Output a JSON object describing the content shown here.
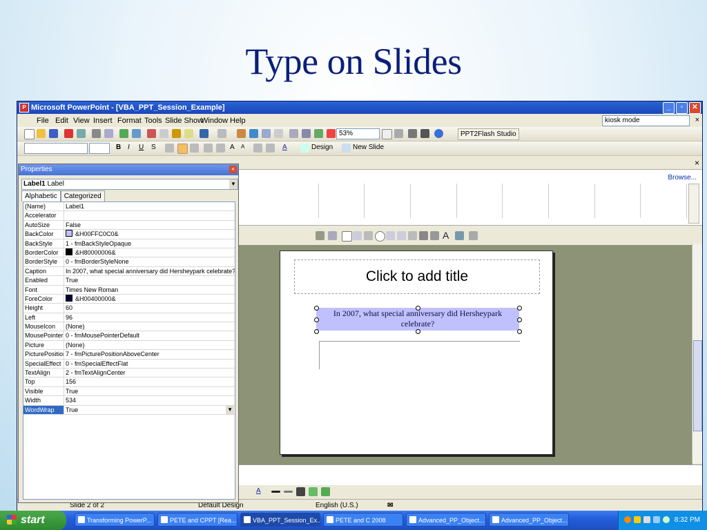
{
  "slide_title": "Type on Slides",
  "window": {
    "title": "Microsoft PowerPoint - [VBA_PPT_Session_Example]",
    "buttons": [
      "_",
      "▫",
      "✕"
    ]
  },
  "menu": {
    "items": [
      "File",
      "Edit",
      "View",
      "Insert",
      "Format",
      "Tools",
      "Slide Show",
      "Window",
      "Help"
    ],
    "kiosk_value": "kiosk mode",
    "close": "×"
  },
  "toolbar": {
    "zoom": "53%",
    "ppt2flash": "PPT2Flash Studio",
    "design_btn": "Design",
    "new_slide_btn": "New Slide"
  },
  "taskpane": {
    "browse": "Browse..."
  },
  "properties": {
    "title": "Properties",
    "object_name": "Label1",
    "object_type": "Label",
    "tabs": [
      "Alphabetic",
      "Categorized"
    ],
    "rows": [
      {
        "name": "(Name)",
        "value": "Label1"
      },
      {
        "name": "Accelerator",
        "value": ""
      },
      {
        "name": "AutoSize",
        "value": "False"
      },
      {
        "name": "BackColor",
        "value": "&H00FFC0C0&",
        "swatch": "#c0c0ff"
      },
      {
        "name": "BackStyle",
        "value": "1 - fmBackStyleOpaque"
      },
      {
        "name": "BorderColor",
        "value": "&H80000006&",
        "swatch": "#000000"
      },
      {
        "name": "BorderStyle",
        "value": "0 - fmBorderStyleNone"
      },
      {
        "name": "Caption",
        "value": "In 2007, what special anniversary did Hersheypark celebrate?"
      },
      {
        "name": "Enabled",
        "value": "True"
      },
      {
        "name": "Font",
        "value": "Times New Roman"
      },
      {
        "name": "ForeColor",
        "value": "&H00400000&",
        "swatch": "#000040"
      },
      {
        "name": "Height",
        "value": "60"
      },
      {
        "name": "Left",
        "value": "96"
      },
      {
        "name": "MouseIcon",
        "value": "(None)"
      },
      {
        "name": "MousePointer",
        "value": "0 - fmMousePointerDefault"
      },
      {
        "name": "Picture",
        "value": "(None)"
      },
      {
        "name": "PicturePosition",
        "value": "7 - fmPicturePositionAboveCenter"
      },
      {
        "name": "SpecialEffect",
        "value": "0 - fmSpecialEffectFlat"
      },
      {
        "name": "TextAlign",
        "value": "2 - fmTextAlignCenter"
      },
      {
        "name": "Top",
        "value": "156"
      },
      {
        "name": "Visible",
        "value": "True"
      },
      {
        "name": "Width",
        "value": "534"
      },
      {
        "name": "WordWrap",
        "value": "True",
        "selected": true
      }
    ]
  },
  "slide": {
    "title_placeholder": "Click to add title",
    "label_caption": "In 2007, what special anniversary did Hersheypark celebrate?"
  },
  "status": {
    "slide": "Slide 2 of 2",
    "design": "Default Design",
    "language": "English (U.S.)"
  },
  "taskbar": {
    "start": "start",
    "tasks": [
      "Transforming PowerP...",
      "PETE and CPPT [Rea...",
      "VBA_PPT_Session_Ex...",
      "PETE and C 2008",
      "Advanced_PP_Object...",
      "Advanced_PP_Object..."
    ],
    "active_task_index": 2,
    "clock": "8:32 PM"
  },
  "colors": {
    "title_text": "#0b1f7a",
    "label_bg": "#c0c0ff",
    "workspace": "#8c9376",
    "taskbar": "#245edb"
  }
}
